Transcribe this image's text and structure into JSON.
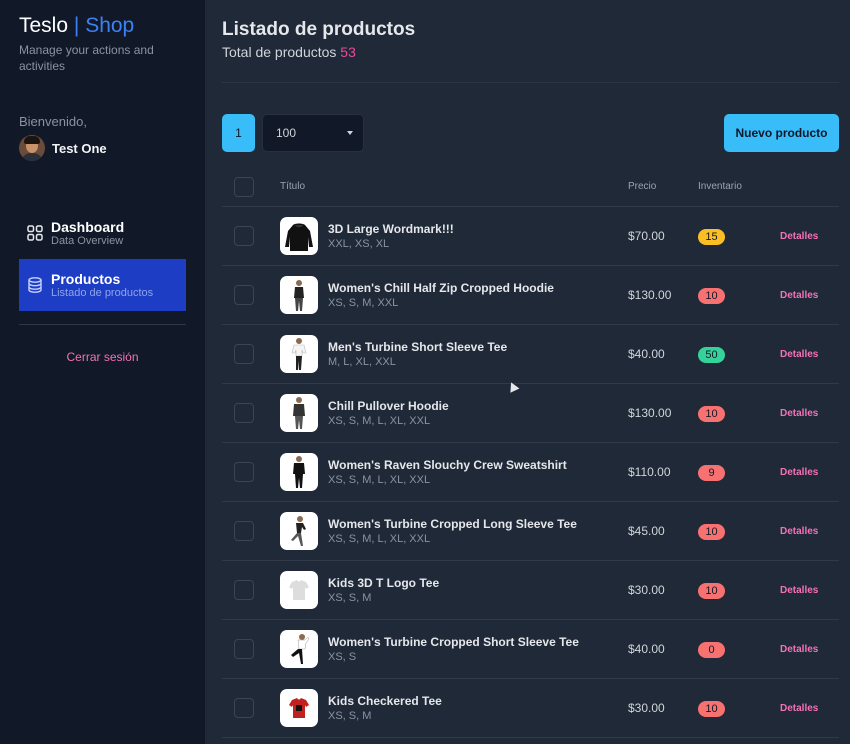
{
  "sidebar": {
    "brand_name": "Teslo",
    "brand_sep": "|",
    "brand_shop": "Shop",
    "brand_tagline": "Manage your actions and activities",
    "welcome": "Bienvenido,",
    "user_name": "Test One",
    "nav": [
      {
        "title": "Dashboard",
        "subtitle": "Data Overview",
        "icon": "grid-icon",
        "active": false
      },
      {
        "title": "Productos",
        "subtitle": "Listado de productos",
        "icon": "database-icon",
        "active": true
      }
    ],
    "logout": "Cerrar sesión"
  },
  "header": {
    "title": "Listado de productos",
    "subtitle_prefix": "Total de productos",
    "total": "53"
  },
  "toolbar": {
    "page": "1",
    "per_page": "100",
    "new_product": "Nuevo producto"
  },
  "table": {
    "columns": {
      "title": "Título",
      "price": "Precio",
      "inventory": "Inventario"
    },
    "action_label": "Detalles",
    "rows": [
      {
        "name": "3D Large Wordmark!!!",
        "sizes": "XXL, XS, XL",
        "price": "$70.00",
        "stock": "15",
        "stock_color": "#fbbf24",
        "thumb": "black-hoodie"
      },
      {
        "name": "Women's Chill Half Zip Cropped Hoodie",
        "sizes": "XS, S, M, XXL",
        "price": "$130.00",
        "stock": "10",
        "stock_color": "#f87171",
        "thumb": "model-woman"
      },
      {
        "name": "Men's Turbine Short Sleeve Tee",
        "sizes": "M, L, XL, XXL",
        "price": "$40.00",
        "stock": "50",
        "stock_color": "#34d399",
        "thumb": "model-man"
      },
      {
        "name": "Chill Pullover Hoodie",
        "sizes": "XS, S, M, L, XL, XXL",
        "price": "$130.00",
        "stock": "10",
        "stock_color": "#f87171",
        "thumb": "model-hoodie"
      },
      {
        "name": "Women's Raven Slouchy Crew Sweatshirt",
        "sizes": "XS, S, M, L, XL, XXL",
        "price": "$110.00",
        "stock": "9",
        "stock_color": "#f87171",
        "thumb": "model-woman-black"
      },
      {
        "name": "Women's Turbine Cropped Long Sleeve Tee",
        "sizes": "XS, S, M, L, XL, XXL",
        "price": "$45.00",
        "stock": "10",
        "stock_color": "#f87171",
        "thumb": "model-running"
      },
      {
        "name": "Kids 3D T Logo Tee",
        "sizes": "XS, S, M",
        "price": "$30.00",
        "stock": "10",
        "stock_color": "#f87171",
        "thumb": "kids-tee-white"
      },
      {
        "name": "Women's Turbine Cropped Short Sleeve Tee",
        "sizes": "XS, S",
        "price": "$40.00",
        "stock": "0",
        "stock_color": "#f87171",
        "thumb": "model-jumping"
      },
      {
        "name": "Kids Checkered Tee",
        "sizes": "XS, S, M",
        "price": "$30.00",
        "stock": "10",
        "stock_color": "#f87171",
        "thumb": "kids-tee-red"
      }
    ]
  },
  "colors": {
    "accent": "#38bdf8",
    "brand": "#3b82f6",
    "link": "#f472b6",
    "sidebar_active": "#1d3dc4"
  }
}
